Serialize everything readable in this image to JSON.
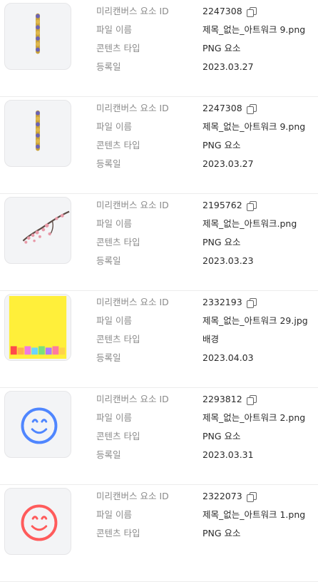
{
  "labels": {
    "id": "미리캔버스 요소 ID",
    "filename": "파일 이름",
    "content_type": "콘텐츠 타입",
    "date": "등록일"
  },
  "items": [
    {
      "id": "2247308",
      "filename": "제목_없는_아트워크 9.png",
      "content_type": "PNG 요소",
      "date": "2023.03.27",
      "thumb_icon": "beaded-stick-icon"
    },
    {
      "id": "2247308",
      "filename": "제목_없는_아트워크 9.png",
      "content_type": "PNG 요소",
      "date": "2023.03.27",
      "thumb_icon": "beaded-stick-icon"
    },
    {
      "id": "2195762",
      "filename": "제목_없는_아트워크.png",
      "content_type": "PNG 요소",
      "date": "2023.03.23",
      "thumb_icon": "cherry-blossom-branch-icon"
    },
    {
      "id": "2332193",
      "filename": "제목_없는_아트워크 29.jpg",
      "content_type": "배경",
      "date": "2023.04.03",
      "thumb_icon": "yellow-gift-background-icon"
    },
    {
      "id": "2293812",
      "filename": "제목_없는_아트워크 2.png",
      "content_type": "PNG 요소",
      "date": "2023.03.31",
      "thumb_icon": "blue-smiley-icon"
    },
    {
      "id": "2322073",
      "filename": "제목_없는_아트워크 1.png",
      "content_type": "PNG 요소",
      "date": "",
      "thumb_icon": "red-smiley-icon"
    }
  ]
}
